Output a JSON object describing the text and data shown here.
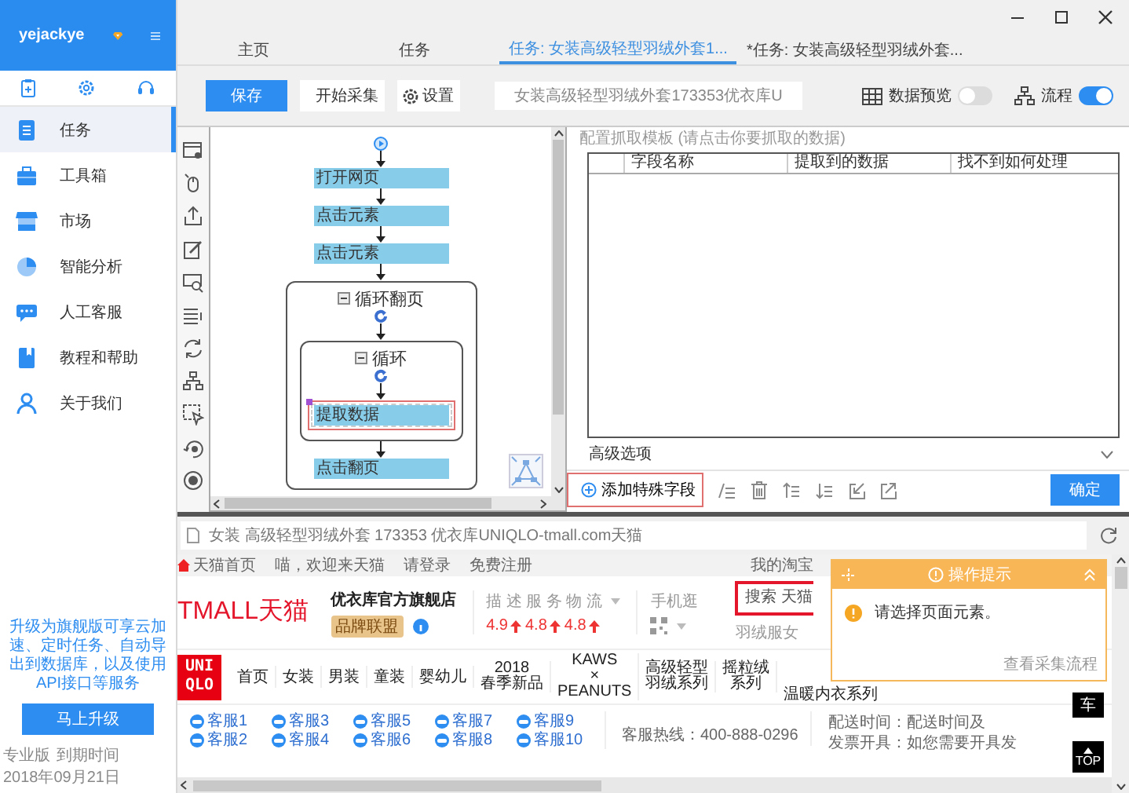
{
  "sidebar": {
    "user": "yejackye",
    "nav": [
      {
        "label": "任务",
        "selected": true
      },
      {
        "label": "工具箱",
        "selected": false
      },
      {
        "label": "市场",
        "selected": false
      },
      {
        "label": "智能分析",
        "selected": false
      },
      {
        "label": "人工客服",
        "selected": false
      },
      {
        "label": "教程和帮助",
        "selected": false
      },
      {
        "label": "关于我们",
        "selected": false
      }
    ],
    "promo": "升级为旗舰版可享云加速、定时任务、自动导出到数据库，以及使用API接口等服务",
    "upgrade_button": "马上升级",
    "edition": "专业版",
    "expiry_label": "到期时间",
    "expiry_date": "2018年09月21日"
  },
  "tabs": [
    {
      "label": "主页",
      "selected": false
    },
    {
      "label": "任务",
      "selected": false
    },
    {
      "label": "任务: 女装高级轻型羽绒外套1...",
      "selected": true
    },
    {
      "label": "*任务: 女装高级轻型羽绒外套...",
      "selected": false
    }
  ],
  "toolbar": {
    "save_button": "保存",
    "start_button": "开始采集",
    "settings_button": "设置",
    "url": "女装高级轻型羽绒外套173353优衣库U",
    "data_preview": {
      "label": "数据预览",
      "on": false
    },
    "flow_view": {
      "label": "流程",
      "on": true
    }
  },
  "flow": [
    {
      "kind": "step",
      "label": "打开网页",
      "selected": false
    },
    {
      "kind": "step",
      "label": "点击元素",
      "selected": false
    },
    {
      "kind": "step",
      "label": "点击元素",
      "selected": false
    },
    {
      "kind": "loop",
      "label": "循环翻页",
      "selected": false,
      "expanded": true,
      "children": [
        {
          "kind": "loop",
          "label": "循环",
          "selected": false,
          "expanded": true,
          "children": [
            {
              "kind": "step",
              "label": "提取数据",
              "selected": true
            }
          ]
        },
        {
          "kind": "step",
          "label": "点击翻页",
          "selected": false
        }
      ]
    }
  ],
  "extract": {
    "title": "配置抓取模板 (请点击你要抓取的数据)",
    "columns": [
      "字段名称",
      "提取到的数据",
      "找不到如何处理"
    ],
    "advanced": "高级选项",
    "add_field_button": "添加特殊字段",
    "confirm_button": "确定"
  },
  "browser": {
    "address": "女装 高级轻型羽绒外套 173353 优衣库UNIQLO-tmall.com天猫",
    "top_links": [
      "天猫首页",
      "喵，欢迎来天猫",
      "请登录",
      "免费注册"
    ],
    "my_taobao": "我的淘宝",
    "logo": "TMALL天猫",
    "store": "优衣库官方旗舰店",
    "store_badge": "品牌联盟",
    "ratings_label": "描 述 服 务 物 流",
    "ratings": [
      "4.9",
      "4.8",
      "4.8"
    ],
    "mobile": "手机逛",
    "search": "搜索 天猫",
    "hot_search": "羽绒服女",
    "brand_logo": [
      "UNI",
      "QLO"
    ],
    "nav": [
      {
        "lines": [
          "首页"
        ]
      },
      {
        "lines": [
          "女装"
        ]
      },
      {
        "lines": [
          "男装"
        ]
      },
      {
        "lines": [
          "童装"
        ]
      },
      {
        "lines": [
          "婴幼儿"
        ]
      },
      {
        "lines": [
          "2018",
          "春季新品"
        ]
      },
      {
        "lines": [
          "KAWS",
          "×",
          "PEANUTS"
        ]
      },
      {
        "lines": [
          "高级轻型",
          "羽绒系列"
        ]
      },
      {
        "lines": [
          "摇粒绒",
          "系列"
        ]
      }
    ],
    "nav_partial": "温暖内衣系列",
    "service": [
      "客服1",
      "客服2",
      "客服3",
      "客服4",
      "客服5",
      "客服6",
      "客服7",
      "客服8",
      "客服9",
      "客服10"
    ],
    "hotline": "客服热线：400-888-0296",
    "delivery": "配送时间：配送时间及",
    "invoice": "发票开具：如您需要开具发",
    "cart": "车",
    "top_button": "TOP"
  },
  "popup": {
    "title": "操作提示",
    "message": "请选择页面元素。",
    "link": "查看采集流程"
  }
}
